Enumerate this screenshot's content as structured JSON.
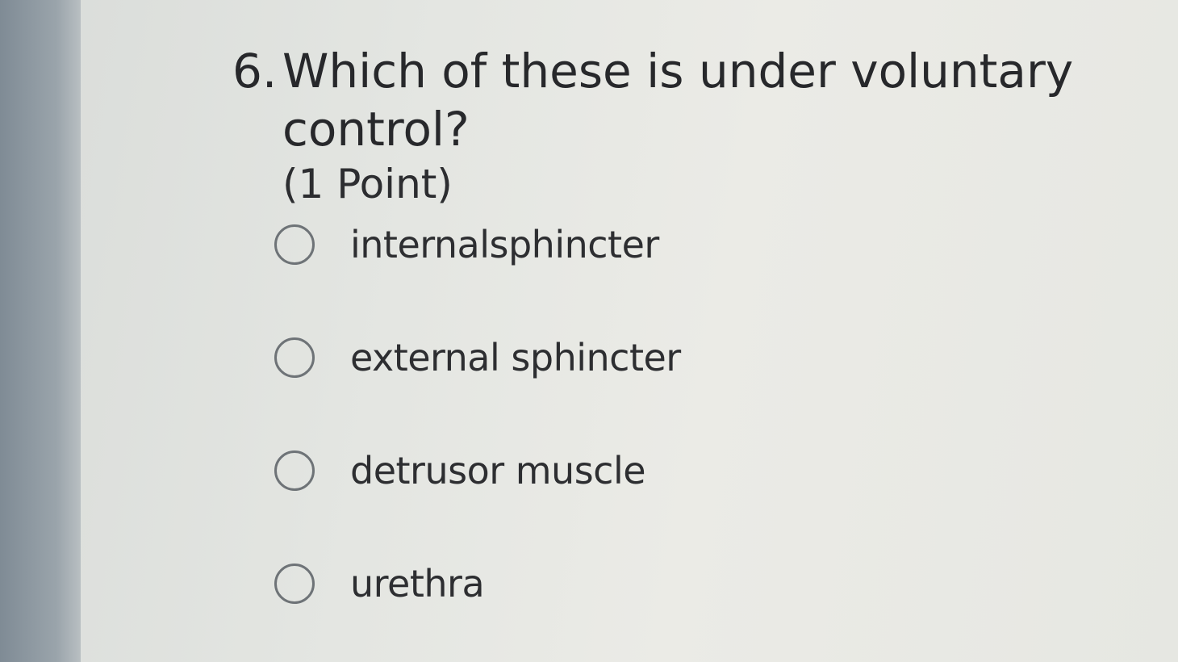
{
  "question": {
    "number": "6.",
    "text": "Which of these is under voluntary control?",
    "points": "(1 Point)"
  },
  "options": [
    {
      "label": "internalsphincter",
      "selected": false
    },
    {
      "label": "external sphincter",
      "selected": false
    },
    {
      "label": "detrusor muscle",
      "selected": false
    },
    {
      "label": "urethra",
      "selected": false
    }
  ],
  "colors": {
    "text": "#2f3033",
    "radio_border": "#6e7377",
    "left_strip": "#8f99a1"
  }
}
